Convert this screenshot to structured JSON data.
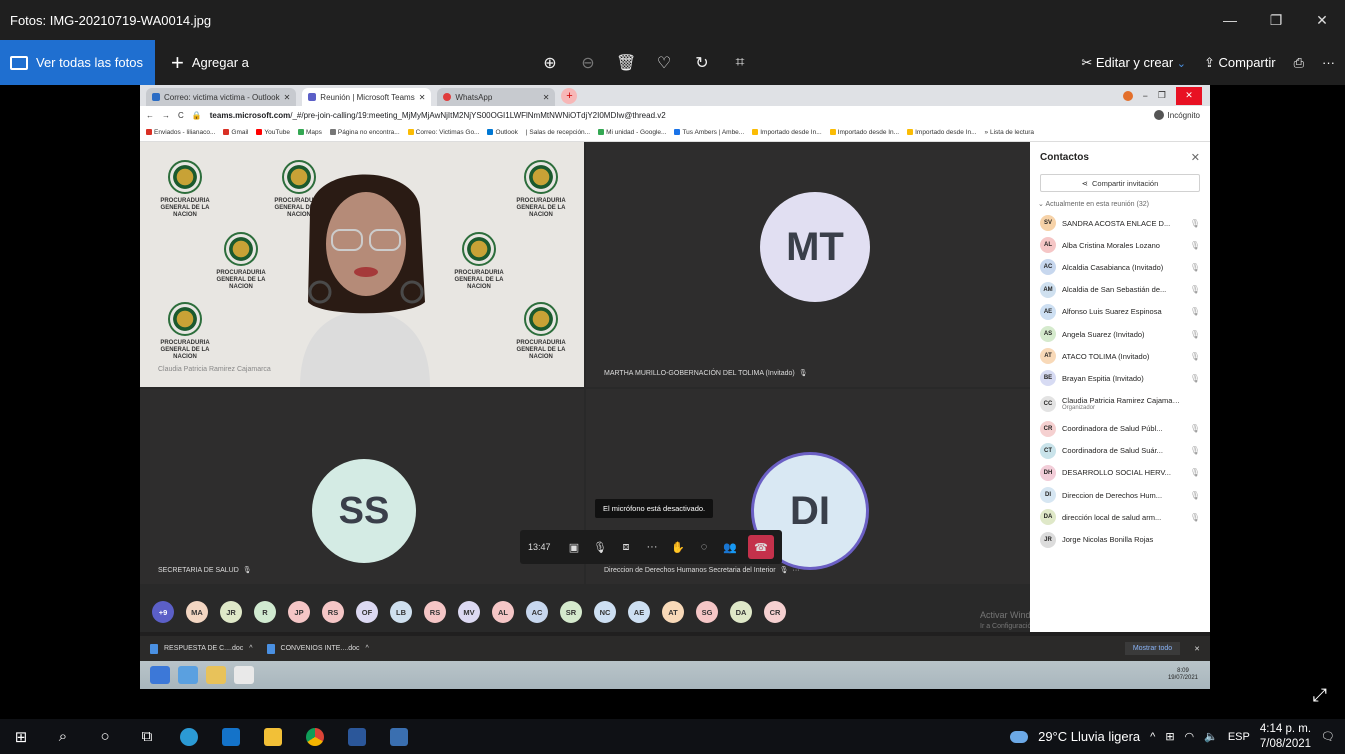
{
  "window": {
    "title": "Fotos: IMG-20210719-WA0014.jpg",
    "minimize": "—",
    "restore": "❐",
    "close": "✕"
  },
  "toolbar": {
    "view_all": "Ver todas las fotos",
    "add_to": "Agregar a",
    "edit_create": "Editar y crear",
    "share": "Compartir",
    "more": "···"
  },
  "browser": {
    "tabs": [
      {
        "label": "Correo: victima victima - Outlook"
      },
      {
        "label": "Reunión | Microsoft Teams"
      },
      {
        "label": "WhatsApp"
      }
    ],
    "url_host": "teams.microsoft.com",
    "url_path": "/_#/pre-join-calling/19:meeting_MjMyMjAwNjItM2NjYS00OGI1LWFlNmMtNWNiOTdjY2I0MDIw@thread.v2",
    "incognito": "Incógnito",
    "bookmarks": [
      "Enviados - lilianaco...",
      "Gmail",
      "YouTube",
      "Maps",
      "Página no encontra...",
      "Correo: Victimas Go...",
      "Outlook",
      "Salas de recepción...",
      "Mi unidad - Google...",
      "Tus Ambers | Ambe...",
      "Importado desde In...",
      "Importado desde In...",
      "Importado desde In...",
      "Lista de lectura"
    ]
  },
  "meeting": {
    "tile_cp_name": "Claudia Patricia Ramirez Cajamarca",
    "logo_text": "PROCURADURIA GENERAL DE LA NACION",
    "tile_mt_initials": "MT",
    "tile_mt_name": "MARTHA MURILLO-GOBERNACIÓN DEL TOLIMA (Invitado)",
    "tile_ss_initials": "SS",
    "tile_ss_name": "SECRETARIA DE SALUD",
    "tile_di_initials": "DI",
    "tile_di_name": "Direccion de Derechos Humanos Secretaria del Interior",
    "tooltip": "El micrófono está desactivado.",
    "call_time": "13:47",
    "more_badge": "+9",
    "participants": [
      "MA",
      "JR",
      "R",
      "JP",
      "RS",
      "OF",
      "LB",
      "RS",
      "MV",
      "AL",
      "AC",
      "SR",
      "NC",
      "AE",
      "AT",
      "SG",
      "DA",
      "CR"
    ]
  },
  "contacts": {
    "title": "Contactos",
    "invite": "Compartir invitación",
    "section": "Actualmente en esta reunión (32)",
    "people": [
      {
        "initials": "SV",
        "name": "SANDRA ACOSTA ENLACE D...",
        "color": "#f6d2a8"
      },
      {
        "initials": "AL",
        "name": "Alba Cristina Morales Lozano",
        "color": "#f5c6c6"
      },
      {
        "initials": "AC",
        "name": "Alcaldia Casabianca (Invitado)",
        "color": "#c7d7ee"
      },
      {
        "initials": "AM",
        "name": "Alcaldia de San Sebastián de...",
        "color": "#cfe0ef"
      },
      {
        "initials": "AE",
        "name": "Alfonso Luis Suarez Espinosa",
        "color": "#cddff2"
      },
      {
        "initials": "AS",
        "name": "Angela Suarez (Invitado)",
        "color": "#d5eacd"
      },
      {
        "initials": "AT",
        "name": "ATACO TOLIMA (Invitado)",
        "color": "#f8d9b8"
      },
      {
        "initials": "BE",
        "name": "Brayan Espitia (Invitado)",
        "color": "#d7dbf3"
      },
      {
        "initials": "CC",
        "name": "Claudia Patricia Ramirez Cajamarca",
        "sub": "Organizador",
        "color": "#e3e3e3"
      },
      {
        "initials": "CR",
        "name": "Coordinadora de Salud Públ...",
        "color": "#f5d0d0"
      },
      {
        "initials": "CT",
        "name": "Coordinadora de Salud Suár...",
        "color": "#c9e3ea"
      },
      {
        "initials": "DH",
        "name": "DESARROLLO SOCIAL HERV...",
        "color": "#f2cdd8"
      },
      {
        "initials": "DI",
        "name": "Direccion de Derechos Hum...",
        "color": "#d6e6f2"
      },
      {
        "initials": "DA",
        "name": "dirección local de salud arm...",
        "color": "#dfe8c8"
      },
      {
        "initials": "JR",
        "name": "Jorge Nicolas Bonilla Rojas",
        "color": "#dcdcdc"
      }
    ]
  },
  "watermark": {
    "line1": "Activar Windows",
    "line2": "Ir a Configuración de PC para activar Windows."
  },
  "downloads": {
    "items": [
      "RESPUESTA DE C....doc",
      "CONVENIOS INTE....doc"
    ],
    "show_all": "Mostrar todo"
  },
  "photo_taskbar": {
    "time": "8:09",
    "date": "19/07/2021"
  },
  "taskbar": {
    "weather": "29°C  Lluvia ligera",
    "lang": "ESP",
    "time": "4:14 p. m.",
    "date": "7/08/2021"
  },
  "colors": {
    "accent": "#1f6fd0",
    "hangup": "#c4314b",
    "teams_ring": "#6b5fc4"
  }
}
